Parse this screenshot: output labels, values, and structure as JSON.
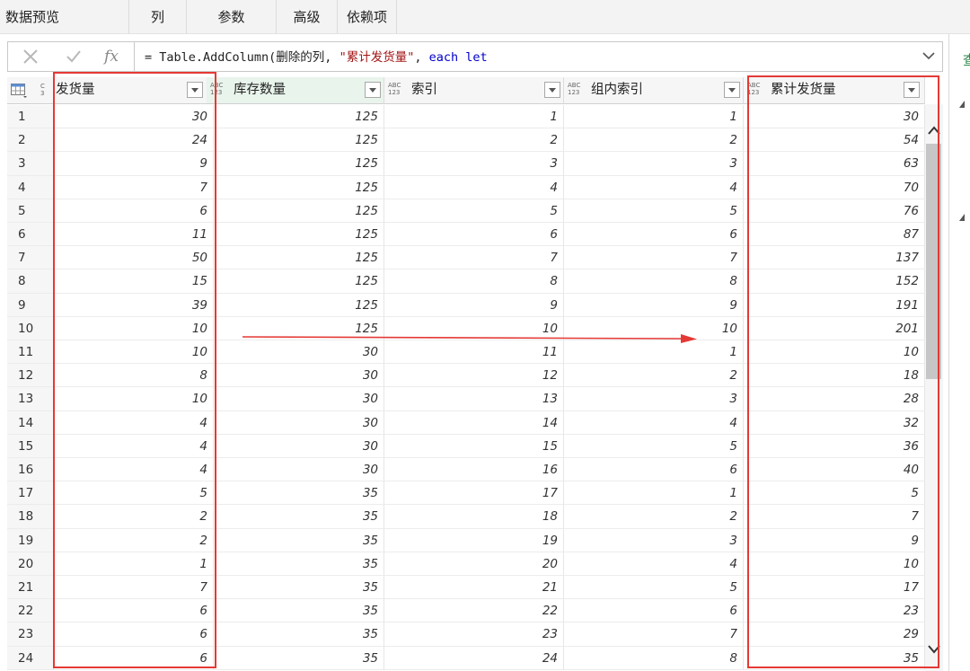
{
  "ribbon": {
    "tabs": [
      "数据预览",
      "列",
      "参数",
      "高级",
      "依赖项"
    ]
  },
  "formula_bar": {
    "cancel_icon": "x-icon",
    "confirm_icon": "check-icon",
    "fx_label": "fx",
    "formula_text": {
      "prefix": "= Table.AddColumn(删除的列, ",
      "string": "\"累计发货量\"",
      "comma": ", ",
      "kw1": "each",
      "space": " ",
      "kw2": "let"
    }
  },
  "table": {
    "type_label_abc": "ABC",
    "type_label_123": "123",
    "columns": [
      {
        "label": "发货量",
        "type": "C3"
      },
      {
        "label": "库存数量",
        "type": "ABC123"
      },
      {
        "label": "索引",
        "type": "ABC123"
      },
      {
        "label": "组内索引",
        "type": "ABC123"
      },
      {
        "label": "累计发货量",
        "type": "ABC123"
      }
    ],
    "rows": [
      {
        "i": "1",
        "v": [
          "30",
          "125",
          "1",
          "1",
          "30"
        ]
      },
      {
        "i": "2",
        "v": [
          "24",
          "125",
          "2",
          "2",
          "54"
        ]
      },
      {
        "i": "3",
        "v": [
          "9",
          "125",
          "3",
          "3",
          "63"
        ]
      },
      {
        "i": "4",
        "v": [
          "7",
          "125",
          "4",
          "4",
          "70"
        ]
      },
      {
        "i": "5",
        "v": [
          "6",
          "125",
          "5",
          "5",
          "76"
        ]
      },
      {
        "i": "6",
        "v": [
          "11",
          "125",
          "6",
          "6",
          "87"
        ]
      },
      {
        "i": "7",
        "v": [
          "50",
          "125",
          "7",
          "7",
          "137"
        ]
      },
      {
        "i": "8",
        "v": [
          "15",
          "125",
          "8",
          "8",
          "152"
        ]
      },
      {
        "i": "9",
        "v": [
          "39",
          "125",
          "9",
          "9",
          "191"
        ]
      },
      {
        "i": "10",
        "v": [
          "10",
          "125",
          "10",
          "10",
          "201"
        ]
      },
      {
        "i": "11",
        "v": [
          "10",
          "30",
          "11",
          "1",
          "10"
        ]
      },
      {
        "i": "12",
        "v": [
          "8",
          "30",
          "12",
          "2",
          "18"
        ]
      },
      {
        "i": "13",
        "v": [
          "10",
          "30",
          "13",
          "3",
          "28"
        ]
      },
      {
        "i": "14",
        "v": [
          "4",
          "30",
          "14",
          "4",
          "32"
        ]
      },
      {
        "i": "15",
        "v": [
          "4",
          "30",
          "15",
          "5",
          "36"
        ]
      },
      {
        "i": "16",
        "v": [
          "4",
          "30",
          "16",
          "6",
          "40"
        ]
      },
      {
        "i": "17",
        "v": [
          "5",
          "35",
          "17",
          "1",
          "5"
        ]
      },
      {
        "i": "18",
        "v": [
          "2",
          "35",
          "18",
          "2",
          "7"
        ]
      },
      {
        "i": "19",
        "v": [
          "2",
          "35",
          "19",
          "3",
          "9"
        ]
      },
      {
        "i": "20",
        "v": [
          "1",
          "35",
          "20",
          "4",
          "10"
        ]
      },
      {
        "i": "21",
        "v": [
          "7",
          "35",
          "21",
          "5",
          "17"
        ]
      },
      {
        "i": "22",
        "v": [
          "6",
          "35",
          "22",
          "6",
          "23"
        ]
      },
      {
        "i": "23",
        "v": [
          "6",
          "35",
          "23",
          "7",
          "29"
        ]
      },
      {
        "i": "24",
        "v": [
          "6",
          "35",
          "24",
          "8",
          "35"
        ]
      }
    ]
  },
  "right_panel": {
    "link_glyph": "查"
  },
  "colors": {
    "annotation": "#e53935",
    "string_literal": "#a31515",
    "keyword": "#0000cc"
  }
}
